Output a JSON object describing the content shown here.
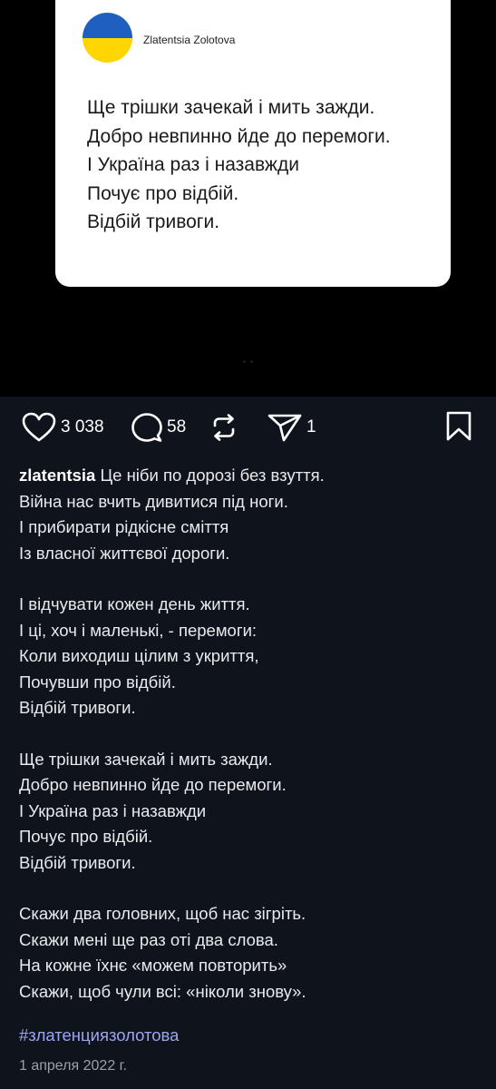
{
  "card": {
    "author": "Zlatentsia Zolotova",
    "poem_lines": [
      "Ще трішки зачекай і мить зажди.",
      "Добро невпинно йде до перемоги.",
      "І Україна раз і назавжди",
      "Почує про відбій.",
      "Відбій тривоги."
    ],
    "flag_colors": {
      "top": "#1f5fbf",
      "bottom": "#ffd500"
    }
  },
  "actions": {
    "likes": "3 038",
    "comments": "58",
    "shares": "1",
    "icons": [
      "heart-icon",
      "comment-icon",
      "repost-icon",
      "send-icon",
      "bookmark-icon"
    ]
  },
  "caption": {
    "username": "zlatentsia",
    "first_line_text": "Це ніби по дорозі без взуття.",
    "stanza1": [
      "Війна нас вчить дивитися під ноги.",
      "І прибирати рідкісне сміття",
      "Із власної життєвої дороги."
    ],
    "stanza2": [
      "І відчувати кожен день життя.",
      "І ці, хоч і маленькі, - перемоги:",
      "Коли виходиш цілим з укриття,",
      "Почувши про відбій.",
      "Відбій тривоги."
    ],
    "stanza3": [
      "Ще трішки зачекай і мить зажди.",
      "Добро невпинно йде до перемоги.",
      "І Україна раз і назавжди",
      "Почує про відбій.",
      "Відбій тривоги."
    ],
    "stanza4": [
      "Скажи два головних, щоб нас зігріть.",
      "Скажи мені ще раз оті два слова.",
      "На кожне їхнє «можем повторить»",
      "Скажи, щоб чули всі: «ніколи знову»."
    ],
    "hashtag": "#златенциязолотова",
    "date": "1 апреля 2022 г."
  },
  "colors": {
    "background_top": "#000000",
    "background_post": "#0f141c",
    "text": "#e8eaed",
    "hashtag": "#9aa6f0",
    "date": "#9aa0a6"
  }
}
